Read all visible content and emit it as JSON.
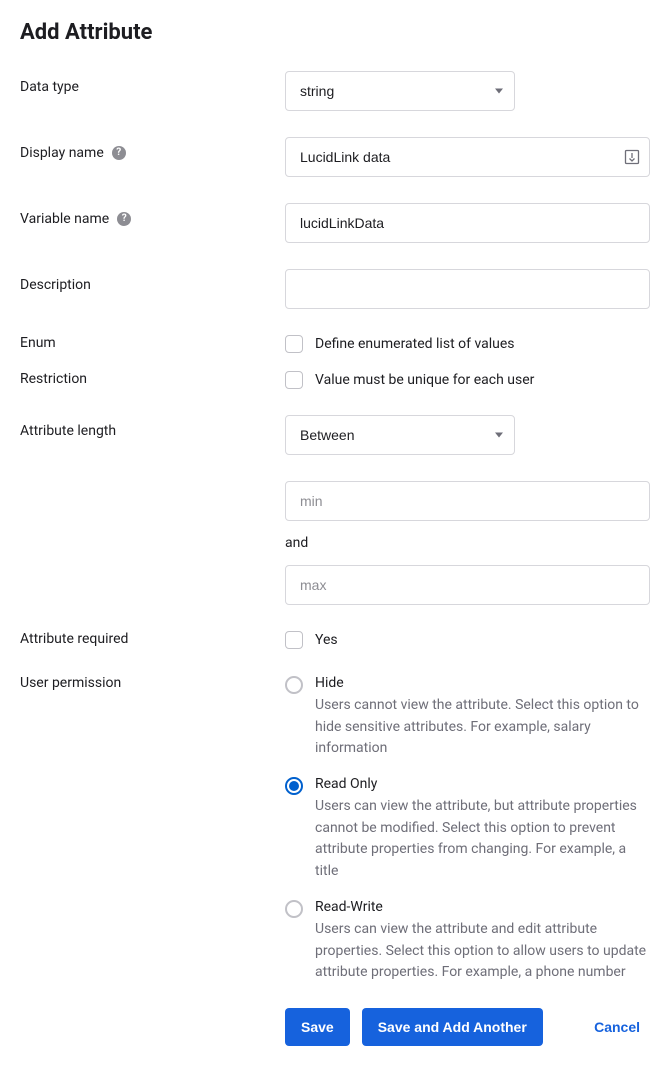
{
  "title": "Add Attribute",
  "labels": {
    "data_type": "Data type",
    "display_name": "Display name",
    "variable_name": "Variable name",
    "description": "Description",
    "enum": "Enum",
    "restriction": "Restriction",
    "attribute_length": "Attribute length",
    "attribute_required": "Attribute required",
    "user_permission": "User permission"
  },
  "fields": {
    "data_type": {
      "value": "string"
    },
    "display_name": {
      "value": "LucidLink data"
    },
    "variable_name": {
      "value": "lucidLinkData"
    },
    "description": {
      "value": ""
    },
    "enum": {
      "label": "Define enumerated list of values",
      "checked": false
    },
    "restriction": {
      "label": "Value must be unique for each user",
      "checked": false
    },
    "attribute_length": {
      "mode": "Between",
      "min_placeholder": "min",
      "and_label": "and",
      "max_placeholder": "max"
    },
    "attribute_required": {
      "label": "Yes",
      "checked": false
    },
    "user_permission": {
      "selected": "read_only",
      "options": {
        "hide": {
          "label": "Hide",
          "desc": "Users cannot view the attribute. Select this option to hide sensitive attributes. For example, salary information"
        },
        "read_only": {
          "label": "Read Only",
          "desc": "Users can view the attribute, but attribute properties cannot be modified. Select this option to prevent attribute properties from changing. For example, a title"
        },
        "read_write": {
          "label": "Read-Write",
          "desc": "Users can view the attribute and edit attribute properties. Select this option to allow users to update attribute properties. For example, a phone number"
        }
      }
    }
  },
  "buttons": {
    "save": "Save",
    "save_add_another": "Save and Add Another",
    "cancel": "Cancel"
  }
}
